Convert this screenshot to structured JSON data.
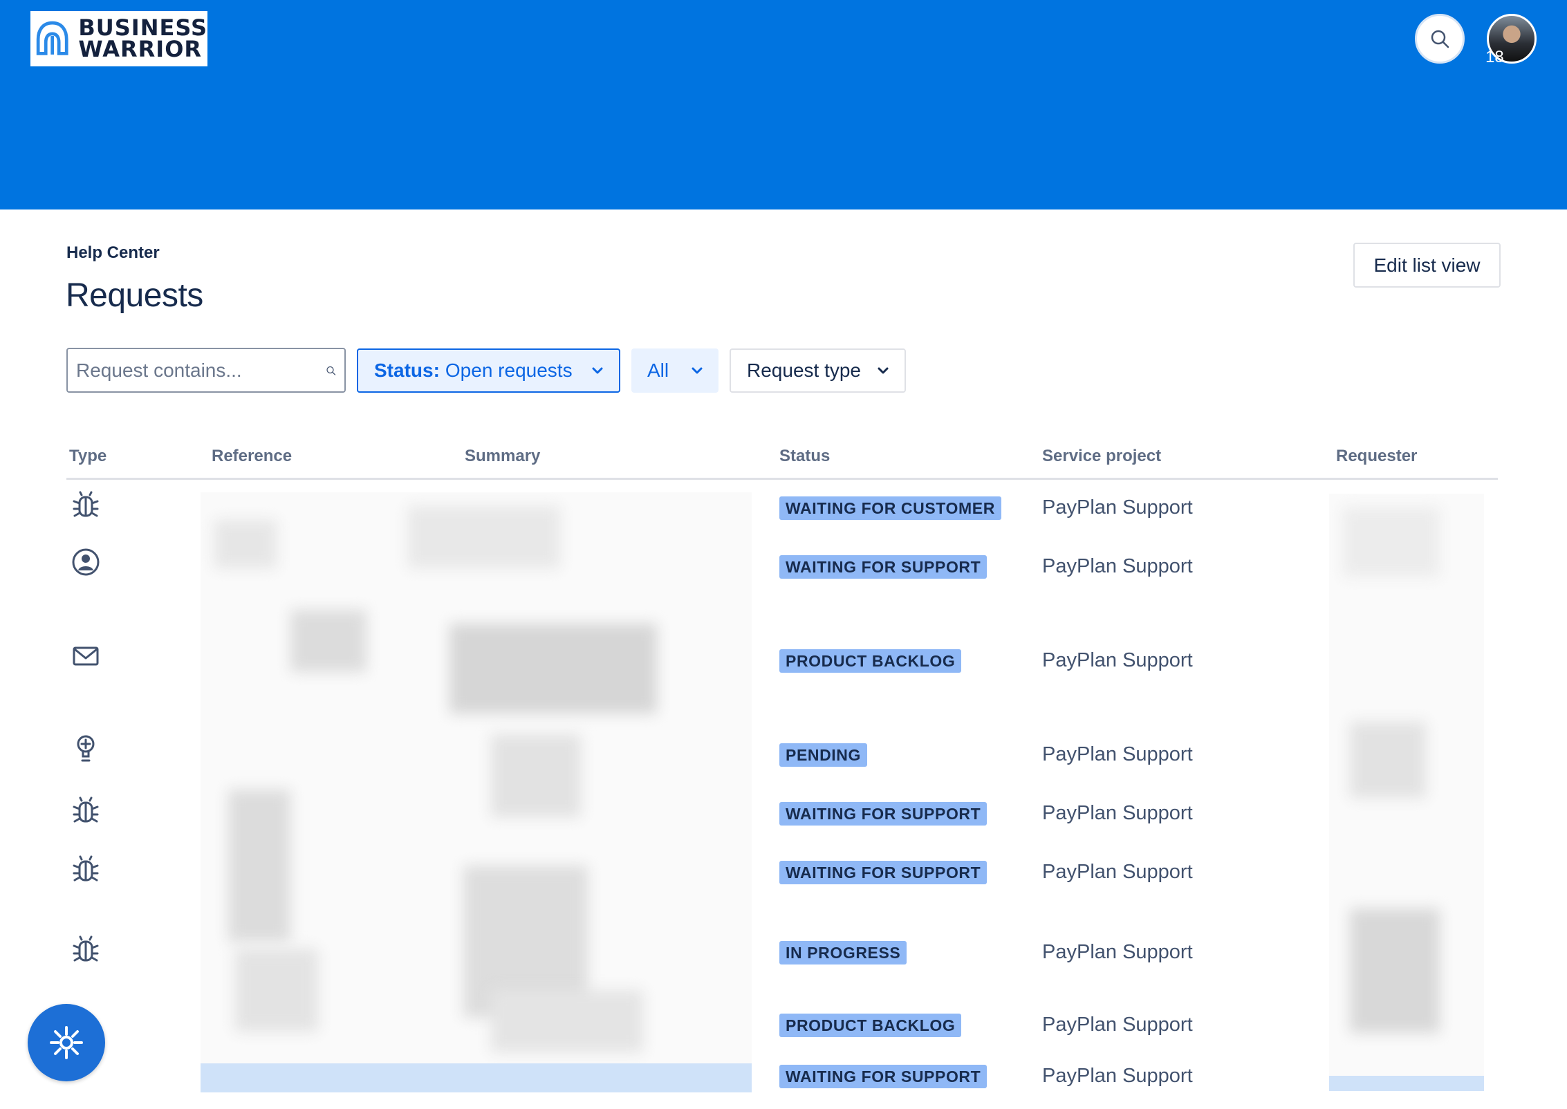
{
  "header": {
    "logo_text": "BUSINESS\nWARRIOR",
    "notification_count": "18",
    "colors": {
      "header_bg": "#0074e0",
      "accent": "#0c66e4",
      "lozenge": "#8fb8f6"
    }
  },
  "breadcrumb": "Help Center",
  "page_title": "Requests",
  "edit_list_view_label": "Edit list view",
  "filters": {
    "search_placeholder": "Request contains...",
    "status_label": "Status:",
    "status_value": "Open requests",
    "all_label": "All",
    "request_type_label": "Request type"
  },
  "table": {
    "columns": [
      "Type",
      "Reference",
      "Summary",
      "Status",
      "Service project",
      "Requester"
    ],
    "rows": [
      {
        "type_icon": "bug-icon",
        "status": "WAITING FOR CUSTOMER",
        "project": "PayPlan Support"
      },
      {
        "type_icon": "user-circle-icon",
        "status": "WAITING FOR SUPPORT",
        "project": "PayPlan Support"
      },
      {
        "type_icon": "envelope-icon",
        "status": "PRODUCT BACKLOG",
        "project": "PayPlan Support"
      },
      {
        "type_icon": "lightbulb-icon",
        "status": "PENDING",
        "project": "PayPlan Support"
      },
      {
        "type_icon": "bug-icon",
        "status": "WAITING FOR SUPPORT",
        "project": "PayPlan Support"
      },
      {
        "type_icon": "bug-icon",
        "status": "WAITING FOR SUPPORT",
        "project": "PayPlan Support"
      },
      {
        "type_icon": "bug-icon",
        "status": "IN PROGRESS",
        "project": "PayPlan Support"
      },
      {
        "type_icon": "bug-icon",
        "status": "PRODUCT BACKLOG",
        "project": "PayPlan Support"
      },
      {
        "type_icon": "lightbulb-icon",
        "status": "WAITING FOR SUPPORT",
        "project": "PayPlan Support"
      }
    ]
  }
}
